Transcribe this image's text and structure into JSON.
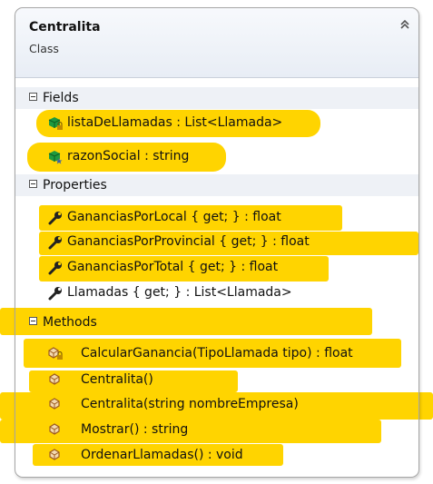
{
  "class": {
    "name": "Centralita",
    "stereotype": "Class"
  },
  "sections": {
    "fields": {
      "label": "Fields",
      "items": [
        {
          "text": "listaDeLlamadas : List<Llamada>",
          "icon": "private-field-icon"
        },
        {
          "text": "razonSocial : string",
          "icon": "protected-field-icon"
        }
      ]
    },
    "properties": {
      "label": "Properties",
      "items": [
        {
          "text": "GananciasPorLocal { get; } : float",
          "icon": "property-wrench-icon"
        },
        {
          "text": "GananciasPorProvincial { get; } : float",
          "icon": "property-wrench-icon"
        },
        {
          "text": "GananciasPorTotal { get; } : float",
          "icon": "property-wrench-icon"
        },
        {
          "text": "Llamadas { get; } : List<Llamada>",
          "icon": "property-wrench-icon"
        }
      ]
    },
    "methods": {
      "label": "Methods",
      "items": [
        {
          "text": "CalcularGanancia(TipoLlamada tipo) : float",
          "icon": "private-method-icon"
        },
        {
          "text": "Centralita()",
          "icon": "method-icon"
        },
        {
          "text": "Centralita(string nombreEmpresa)",
          "icon": "method-icon"
        },
        {
          "text": "Mostrar() : string",
          "icon": "method-icon"
        },
        {
          "text": "OrdenarLlamadas() : void",
          "icon": "method-icon"
        }
      ]
    }
  },
  "colors": {
    "highlight": "#ffd400",
    "field_icon": "#1f9a3f",
    "method_icon": "#9c5a1e",
    "lock": "#c08a00"
  }
}
